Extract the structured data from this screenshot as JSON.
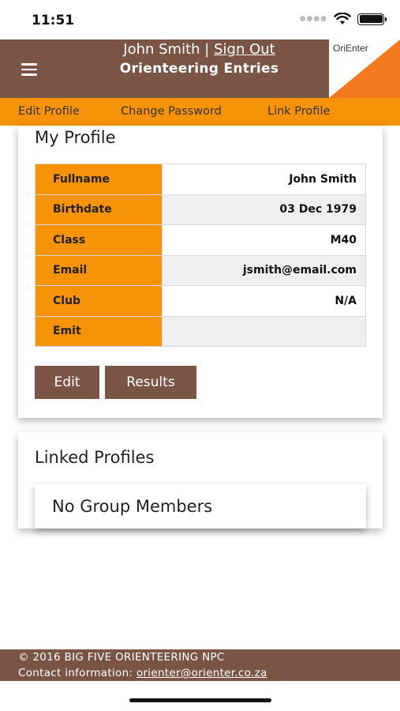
{
  "status_bar": {
    "time": "11:51"
  },
  "header": {
    "user_name": "John Smith",
    "separator": "|",
    "sign_out": "Sign Out",
    "title": "Orienteering Entries",
    "logo_text": "OriEnter",
    "logo_colors": {
      "orange": "#f47a20",
      "white": "#ffffff"
    }
  },
  "subnav": {
    "items": [
      {
        "label": "Edit Profile"
      },
      {
        "label": "Change Password"
      },
      {
        "label": "Link Profile"
      }
    ]
  },
  "profile": {
    "title": "My Profile",
    "rows": [
      {
        "label": "Fullname",
        "value": "John Smith"
      },
      {
        "label": "Birthdate",
        "value": "03 Dec 1979"
      },
      {
        "label": "Class",
        "value": "M40"
      },
      {
        "label": "Email",
        "value": "jsmith@email.com"
      },
      {
        "label": "Club",
        "value": "N/A"
      },
      {
        "label": "Emit",
        "value": ""
      }
    ],
    "edit_button": "Edit",
    "results_button": "Results"
  },
  "linked": {
    "title": "Linked Profiles",
    "empty_text": "No Group Members"
  },
  "footer": {
    "copyright": "© 2016 BIG FIVE ORIENTEERING NPC",
    "contact_label": "Contact information:",
    "contact_email": "orienter@orienter.co.za"
  },
  "colors": {
    "brand_brown": "#7a5546",
    "brand_orange": "#f79308"
  }
}
